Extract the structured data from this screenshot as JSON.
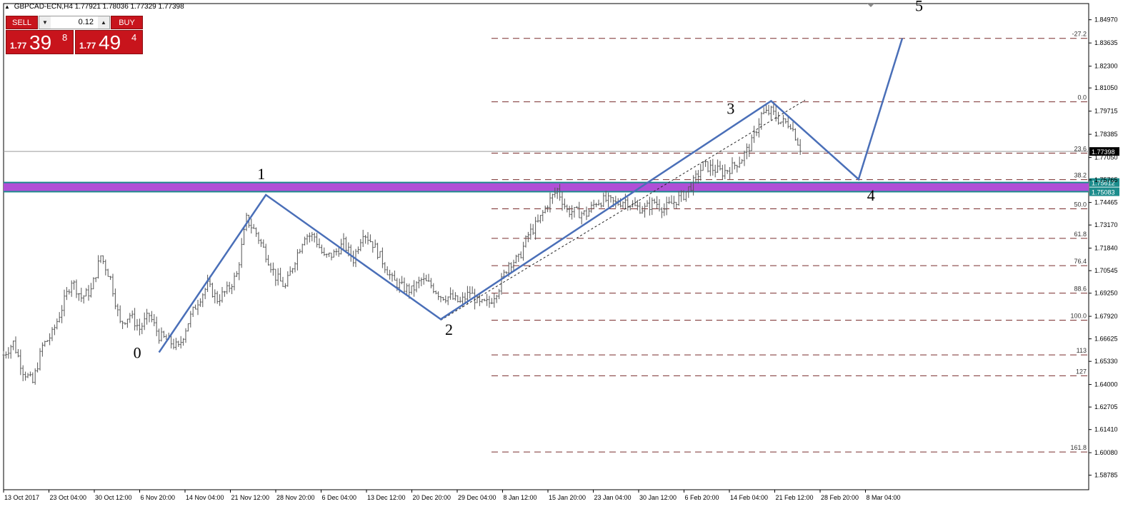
{
  "header": {
    "symbol": "GBPCAD-ECN,H4",
    "ohlc": "1.77921 1.78036 1.77329 1.77398"
  },
  "trade_panel": {
    "sell_label": "SELL",
    "buy_label": "BUY",
    "lot_value": "0.12",
    "sell_price_prefix": "1.77",
    "sell_price_big": "39",
    "sell_price_sup": "8",
    "buy_price_prefix": "1.77",
    "buy_price_big": "49",
    "buy_price_sup": "4"
  },
  "colors": {
    "wave": "#4a6fb8",
    "zone": "#b04fd6",
    "zone_border": "#1c8c8c",
    "fib": "#7a2e2e",
    "candle": "#555555"
  },
  "chart_data": {
    "type": "candlestick",
    "symbol": "GBPCAD-ECN",
    "timeframe": "H4",
    "ylim": [
      1.5795,
      1.859
    ],
    "y_ticks": [
      "1.84970",
      "1.83635",
      "1.82300",
      "1.81050",
      "1.79715",
      "1.78385",
      "1.77050",
      "1.75765",
      "1.74465",
      "1.73170",
      "1.71840",
      "1.70545",
      "1.69250",
      "1.67920",
      "1.66625",
      "1.65330",
      "1.64000",
      "1.62705",
      "1.61410",
      "1.60080",
      "1.58785"
    ],
    "x_ticks": [
      "13 Oct 2017",
      "23 Oct 04:00",
      "30 Oct 12:00",
      "6 Nov 20:00",
      "14 Nov 04:00",
      "21 Nov 12:00",
      "28 Nov 20:00",
      "6 Dec 04:00",
      "13 Dec 12:00",
      "20 Dec 20:00",
      "29 Dec 04:00",
      "8 Jan 12:00",
      "15 Jan 20:00",
      "23 Jan 04:00",
      "30 Jan 12:00",
      "6 Feb 20:00",
      "14 Feb 04:00",
      "21 Feb 12:00",
      "28 Feb 20:00",
      "8 Mar 04:00"
    ],
    "current_price": "1.77398",
    "price_path": [
      [
        0,
        1.657
      ],
      [
        2,
        1.664
      ],
      [
        4,
        1.648
      ],
      [
        6,
        1.641
      ],
      [
        8,
        1.662
      ],
      [
        10,
        1.669
      ],
      [
        12,
        1.684
      ],
      [
        14,
        1.7
      ],
      [
        16,
        1.69
      ],
      [
        18,
        1.694
      ],
      [
        20,
        1.714
      ],
      [
        22,
        1.701
      ],
      [
        24,
        1.675
      ],
      [
        26,
        1.68
      ],
      [
        28,
        1.672
      ],
      [
        30,
        1.68
      ],
      [
        32,
        1.668
      ],
      [
        34,
        1.665
      ],
      [
        36,
        1.661
      ],
      [
        38,
        1.676
      ],
      [
        40,
        1.688
      ],
      [
        42,
        1.697
      ],
      [
        44,
        1.689
      ],
      [
        46,
        1.694
      ],
      [
        48,
        1.703
      ],
      [
        50,
        1.735
      ],
      [
        52,
        1.727
      ],
      [
        54,
        1.715
      ],
      [
        56,
        1.702
      ],
      [
        58,
        1.696
      ],
      [
        60,
        1.712
      ],
      [
        62,
        1.726
      ],
      [
        64,
        1.725
      ],
      [
        66,
        1.713
      ],
      [
        68,
        1.715
      ],
      [
        70,
        1.721
      ],
      [
        72,
        1.712
      ],
      [
        74,
        1.728
      ],
      [
        76,
        1.721
      ],
      [
        78,
        1.711
      ],
      [
        80,
        1.7
      ],
      [
        82,
        1.696
      ],
      [
        84,
        1.694
      ],
      [
        86,
        1.7
      ],
      [
        88,
        1.697
      ],
      [
        90,
        1.691
      ],
      [
        92,
        1.69
      ],
      [
        94,
        1.687
      ],
      [
        96,
        1.693
      ],
      [
        98,
        1.686
      ],
      [
        100,
        1.687
      ],
      [
        102,
        1.696
      ],
      [
        104,
        1.71
      ],
      [
        106,
        1.712
      ],
      [
        108,
        1.726
      ],
      [
        110,
        1.733
      ],
      [
        112,
        1.744
      ],
      [
        114,
        1.752
      ],
      [
        116,
        1.74
      ],
      [
        118,
        1.739
      ],
      [
        120,
        1.738
      ],
      [
        122,
        1.745
      ],
      [
        124,
        1.746
      ],
      [
        126,
        1.744
      ],
      [
        128,
        1.746
      ],
      [
        130,
        1.742
      ],
      [
        132,
        1.741
      ],
      [
        134,
        1.745
      ],
      [
        136,
        1.741
      ],
      [
        138,
        1.745
      ],
      [
        140,
        1.749
      ],
      [
        142,
        1.756
      ],
      [
        144,
        1.766
      ],
      [
        146,
        1.764
      ],
      [
        148,
        1.762
      ],
      [
        150,
        1.765
      ],
      [
        152,
        1.77
      ],
      [
        154,
        1.779
      ],
      [
        156,
        1.795
      ],
      [
        158,
        1.797
      ],
      [
        160,
        1.791
      ],
      [
        162,
        1.79
      ],
      [
        164,
        1.776
      ]
    ],
    "wave_points": [
      {
        "label": "0",
        "t": 32,
        "price": 1.6585
      },
      {
        "label": "1",
        "t": 54,
        "price": 1.749
      },
      {
        "label": "2",
        "t": 90,
        "price": 1.6775
      },
      {
        "label": "3",
        "t": 158,
        "price": 1.803
      },
      {
        "label": "4",
        "t": 176,
        "price": 1.758
      },
      {
        "label": "5",
        "t": 185,
        "price": 1.839
      }
    ],
    "fibonacci": [
      {
        "label": "-27.2",
        "price": 1.839
      },
      {
        "label": "0.0",
        "price": 1.8025
      },
      {
        "label": "23.6",
        "price": 1.773
      },
      {
        "label": "38.2",
        "price": 1.7578
      },
      {
        "label": "50.0",
        "price": 1.741
      },
      {
        "label": "61.8",
        "price": 1.724
      },
      {
        "label": "76.4",
        "price": 1.7083
      },
      {
        "label": "88.6",
        "price": 1.6925
      },
      {
        "label": "100.0",
        "price": 1.677
      },
      {
        "label": "113",
        "price": 1.657
      },
      {
        "label": "127",
        "price": 1.645
      },
      {
        "label": "161.8",
        "price": 1.6012
      }
    ],
    "zone": {
      "top": 1.75612,
      "bottom": 1.75083,
      "labels": [
        "1.75612",
        "1.75083"
      ]
    },
    "trend_channel": {
      "from": {
        "t": 90,
        "price": 1.677
      },
      "to": {
        "t": 165,
        "price": 1.8035
      }
    }
  }
}
